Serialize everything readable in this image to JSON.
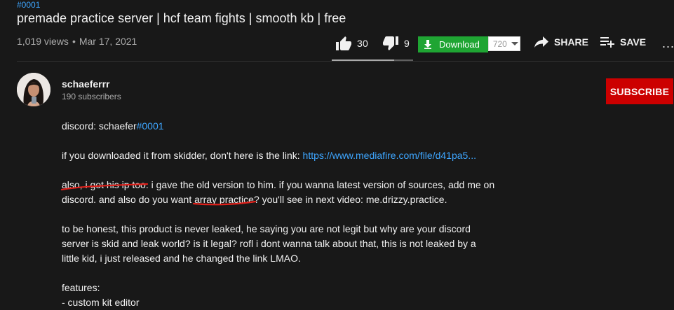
{
  "video": {
    "hashtag": "#0001",
    "title": "premade practice server | hcf team fights | smooth kb | free",
    "views": "1,019 views",
    "date": "Mar 17, 2021",
    "likes": "30",
    "dislikes": "9",
    "like_ratio": 0.77
  },
  "actions": {
    "download_label": "Download",
    "quality": "720",
    "share_label": "SHARE",
    "save_label": "SAVE",
    "more_label": "..."
  },
  "channel": {
    "name": "schaeferrr",
    "subscribers": "190 subscribers",
    "subscribe_label": "SUBSCRIBE"
  },
  "description": {
    "line1_prefix": "discord: schaefer",
    "line1_tag": "#0001",
    "line2_prefix": "if you downloaded it from skidder, don't here is the link: ",
    "line2_link": "https://www.mediafire.com/file/d41pa5...",
    "line3a_hl": "also, i got his ip too.",
    "line3a_rest": " i gave the old version to him. if you wanna latest version of sources, add me on",
    "line3b_prefix": "discord. and also do you want ",
    "line3b_hl": "array practice",
    "line3b_rest": "? you'll see in next video: me.drizzy.practice.",
    "line4a": "to be honest, this product is never leaked, he saying you are not legit but why are your discord",
    "line4b": "server is skid and leak world? is it legal? rofl i dont wanna talk about that, this is not leaked by a",
    "line4c": "little kid, i just released and he changed the link LMAO.",
    "line5": "features:",
    "line6": "- custom kit editor"
  },
  "colors": {
    "background": "#181818",
    "link": "#3ea6ff",
    "subscribe": "#cc0000",
    "download": "#1fa533",
    "annotation": "#e0201a"
  }
}
